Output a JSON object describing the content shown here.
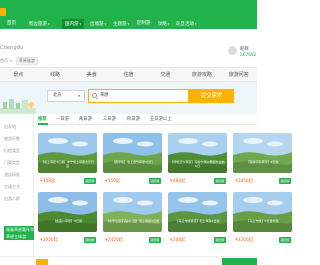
{
  "nav": {
    "items": [
      {
        "label": "首页",
        "caret": false,
        "active": false
      },
      {
        "label": "周边旅游",
        "caret": true,
        "active": false
      },
      {
        "label": "国内游",
        "caret": true,
        "active": true
      },
      {
        "label": "出境游",
        "caret": true,
        "active": false
      },
      {
        "label": "主题游",
        "caret": true,
        "active": false
      },
      {
        "label": "定制游",
        "caret": false,
        "active": false
      },
      {
        "label": "攻略",
        "caret": true,
        "active": false
      },
      {
        "label": "双旦活动",
        "caret": true,
        "active": false
      }
    ]
  },
  "header": {
    "city": "Chengdu",
    "breadcrumb_home": "首页",
    "breadcrumb_sep": ">",
    "breadcrumb_current": "草原旅游"
  },
  "user": {
    "name": "昵称",
    "id": "267692"
  },
  "categories": [
    "景点",
    "线路",
    "美食",
    "住宿",
    "交通",
    "旅游攻略",
    "旅游问答"
  ],
  "search": {
    "select_value": "北京",
    "query": "草原",
    "button_label": "提交需求"
  },
  "left_filters": [
    "出发地",
    "旅游天数",
    "行程类型",
    "门票类型",
    "酒店标准",
    "交通方式",
    "出游人群"
  ],
  "promo_badge": "青春草原嘉年华 草原立体游",
  "listing_tabs": {
    "items": [
      "推荐",
      "一日游",
      "两日游",
      "三日游",
      "四日游",
      "五日游以上"
    ],
    "active_index": 0
  },
  "cards": [
    {
      "caption": "【坝上草原3日游】丰宁坝上草原大汗行宫",
      "price": "¥308起",
      "badge": "跟团游"
    },
    {
      "caption": "【赛罕坝】坝上自驾草原3日行",
      "price": "¥550起",
      "badge": "跟团游"
    },
    {
      "caption": "【呼伦贝尔草原】海拉尔满洲里额尔古纳6日",
      "price": "¥488起",
      "badge": "跟团游"
    },
    {
      "caption": "【锡林郭勒草原】4日游",
      "price": "¥1850起",
      "badge": "跟团游"
    },
    {
      "caption": "【金莲川草原】3日游",
      "price": "¥2950起",
      "badge": "跟团游"
    },
    {
      "caption": "【塞罕坝国家森林公园】坝上草原3日游",
      "price": "¥2450起",
      "badge": "跟团游"
    },
    {
      "caption": "【乌兰布统草原】坝上草原4日游",
      "price": "¥268起",
      "badge": "跟团游"
    },
    {
      "caption": "【乌兰布统】5日自驾游",
      "price": "¥3200起",
      "badge": "跟团游"
    }
  ],
  "colors": {
    "brand_green": "#21b24b",
    "accent_orange": "#ffb100",
    "price_orange": "#f36b1c"
  }
}
